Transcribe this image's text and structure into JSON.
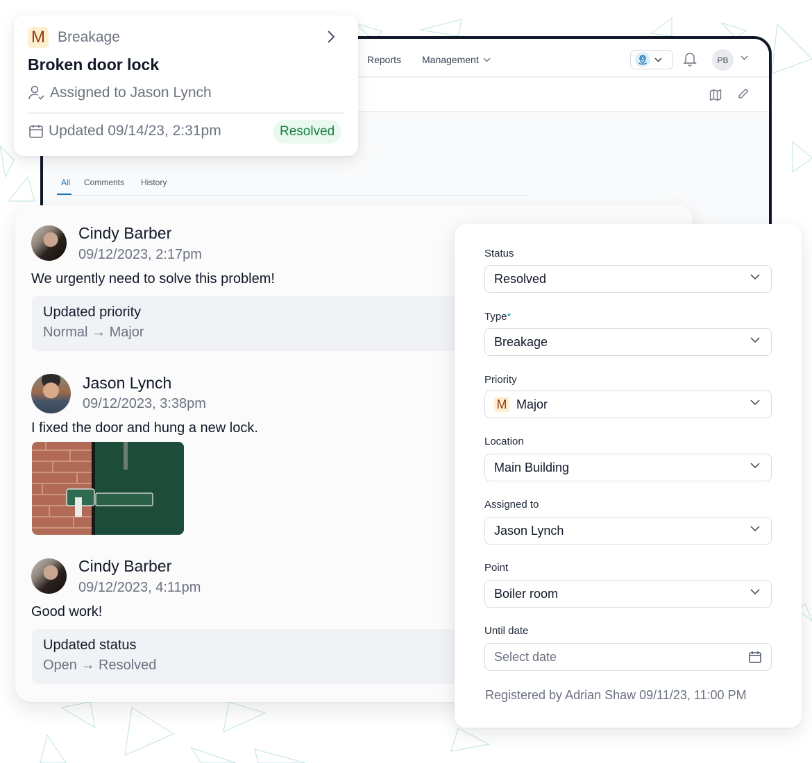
{
  "app": {
    "nav": {
      "reports": "Reports",
      "management": "Management"
    },
    "user_initials": "PB",
    "icons": [
      "location-pin-icon",
      "chevron-down-icon",
      "bell-icon",
      "map-icon",
      "pencil-icon"
    ],
    "tabs": [
      {
        "label": "All",
        "active": true
      },
      {
        "label": "Comments",
        "active": false
      },
      {
        "label": "History",
        "active": false
      }
    ],
    "accent_color": "#1d74b5"
  },
  "ticket": {
    "priority_badge": "M",
    "type": "Breakage",
    "title": "Broken door lock",
    "assigned": "Assigned to Jason Lynch",
    "updated": "Updated 09/14/23, 2:31pm",
    "status": "Resolved",
    "status_color": "#15803d"
  },
  "feed": {
    "entries": [
      {
        "author": "Cindy Barber",
        "time": "09/12/2023, 2:17pm",
        "text": "We urgently need to solve this problem!",
        "change": {
          "title": "Updated priority",
          "detail": "Normal → Major"
        }
      },
      {
        "author": "Jason Lynch",
        "time": "09/12/2023, 3:38pm",
        "text": "I fixed the door and hung a new lock.",
        "attachment": "photo-of-green-door-lock"
      },
      {
        "author": "Cindy Barber",
        "time": "09/12/2023, 4:11pm",
        "text": "Good work!",
        "change": {
          "title": "Updated status",
          "detail": "Open → Resolved"
        }
      }
    ]
  },
  "form": {
    "fields": [
      {
        "label": "Status",
        "value": "Resolved",
        "required": false
      },
      {
        "label": "Type",
        "value": "Breakage",
        "required": true
      },
      {
        "label": "Priority",
        "value": "Major",
        "badge": "M",
        "required": false
      },
      {
        "label": "Location",
        "value": "Main Building",
        "required": false
      },
      {
        "label": "Assigned to",
        "value": "Jason Lynch",
        "required": false
      },
      {
        "label": "Point",
        "value": "Boiler room",
        "required": false
      },
      {
        "label": "Until date",
        "placeholder": "Select date",
        "required": false
      }
    ],
    "required_marker": "*",
    "registered": "Registered by Adrian Shaw 09/11/23, 11:00 PM"
  }
}
